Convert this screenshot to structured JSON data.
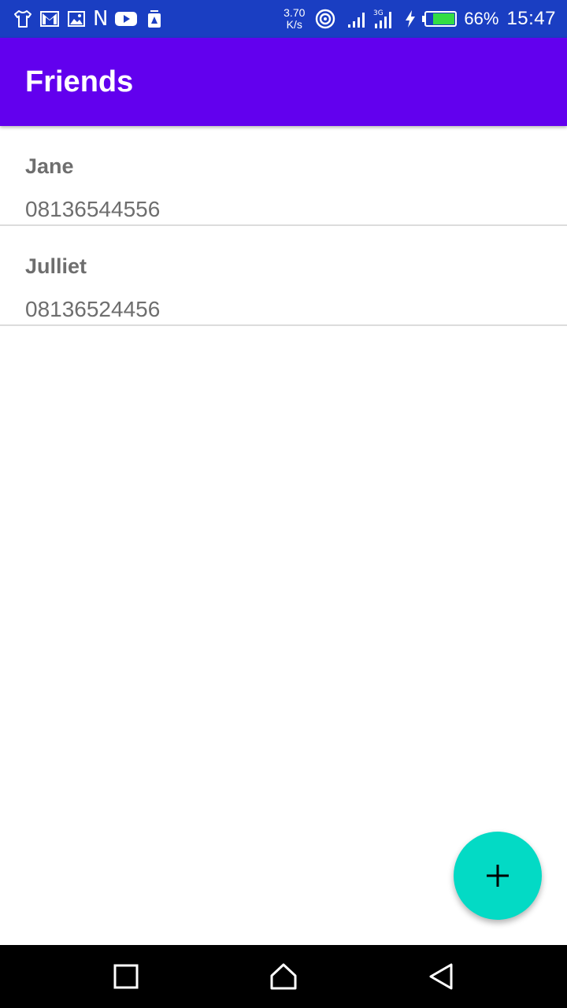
{
  "status_bar": {
    "speed_value": "3.70",
    "speed_unit": "K/s",
    "battery_percent": "66%",
    "time": "15:47",
    "notification_icons": [
      "tshirt-icon",
      "gmail-icon",
      "image-icon",
      "n-icon",
      "youtube-icon",
      "shield-icon"
    ]
  },
  "app_bar": {
    "title": "Friends"
  },
  "friends": [
    {
      "name": "Jane",
      "phone": "08136544556"
    },
    {
      "name": "Julliet",
      "phone": "08136524456"
    }
  ],
  "fab": {
    "icon": "plus-icon"
  },
  "nav": {
    "icons": [
      "recents-icon",
      "home-icon",
      "back-icon"
    ]
  },
  "colors": {
    "status_bar": "#1a3ec2",
    "app_bar": "#6200ee",
    "fab": "#03dac5",
    "text_secondary": "#6e6e6e",
    "divider": "#dcdcdc",
    "battery_fill": "#33dd44"
  }
}
